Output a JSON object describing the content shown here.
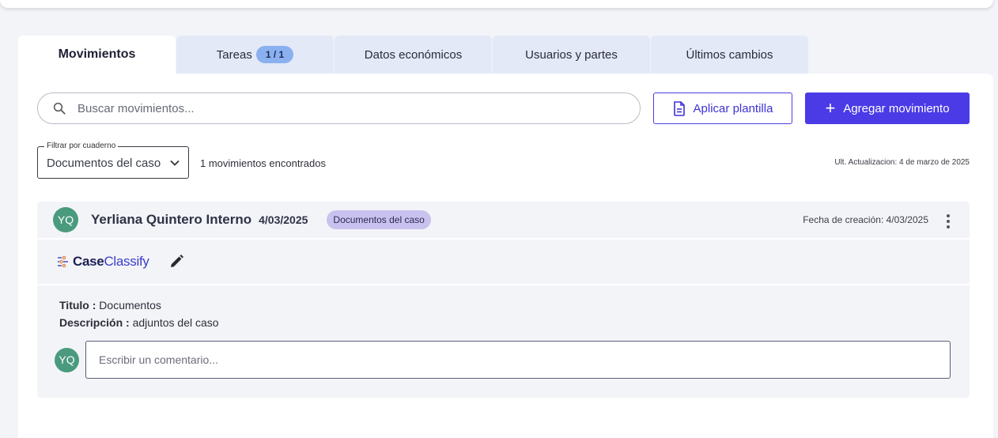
{
  "tabs": [
    {
      "label": "Movimientos"
    },
    {
      "label": "Tareas",
      "badge": "1 / 1"
    },
    {
      "label": "Datos económicos"
    },
    {
      "label": "Usuarios y partes"
    },
    {
      "label": "Últimos cambios"
    }
  ],
  "search": {
    "placeholder": "Buscar movimientos..."
  },
  "actions": {
    "apply_template": "Aplicar plantilla",
    "add_movement": "Agregar movimiento"
  },
  "filter": {
    "legend": "Filtrar por cuaderno",
    "value": "Documentos del caso"
  },
  "results_count": "1 movimientos encontrados",
  "last_update": "Ult. Actualizacion: 4 de marzo de 2025",
  "movement": {
    "avatar": "YQ",
    "author": "Yerliana Quintero Interno",
    "date": "4/03/2025",
    "tag": "Documentos del caso",
    "created": "Fecha de creación: 4/03/2025",
    "logo_bold": "Case",
    "logo_light": "Classify",
    "title_label": "Titulo :",
    "title_value": "Documentos",
    "desc_label": "Descripción :",
    "desc_value": "adjuntos del caso",
    "comment_avatar": "YQ",
    "comment_placeholder": "Escribir un comentario..."
  },
  "colors": {
    "primary": "#4b3be6",
    "avatar": "#4a9a7e",
    "tag": "#c9c2ee",
    "tab_inactive": "#e3e9f7"
  }
}
